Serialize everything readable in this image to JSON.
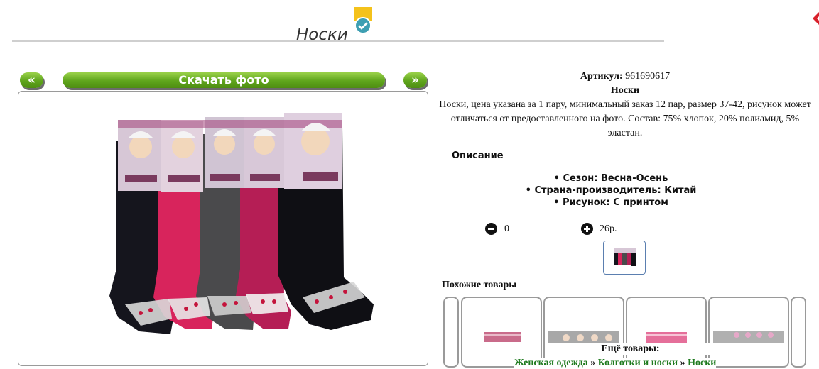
{
  "header": {
    "title": "Носки"
  },
  "toolbar": {
    "prev_label": "«",
    "download_label": "Скачать фото",
    "next_label": "»"
  },
  "product": {
    "sku_label": "Артикул:",
    "sku_value": "961690617",
    "name": "Носки",
    "description": "Носки, цена указана за 1 пару, минимальный заказ 12 пар, размер 37-42, рисунок может отличаться от предоставленного на фото. Состав: 75% хлопок, 20% полиамид, 5% эластан.",
    "details_heading": "Описание",
    "attributes": [
      "Сезон: Весна-Осень",
      "Страна-производитель: Китай",
      "Рисунок: С принтом"
    ],
    "quantity": "0",
    "price": "26р."
  },
  "similar": {
    "heading": "Похожие товары"
  },
  "footer": {
    "more_label": "Ещё товары:",
    "breadcrumb": [
      "Женская одежда",
      "Колготки и носки",
      "Носки"
    ],
    "separator": "»"
  },
  "colors": {
    "button_green": "#6fb42c",
    "link_green": "#1e7a1e",
    "badge_yellow": "#f4c21b",
    "badge_teal": "#3e9fb2",
    "close_red": "#d8202a"
  }
}
